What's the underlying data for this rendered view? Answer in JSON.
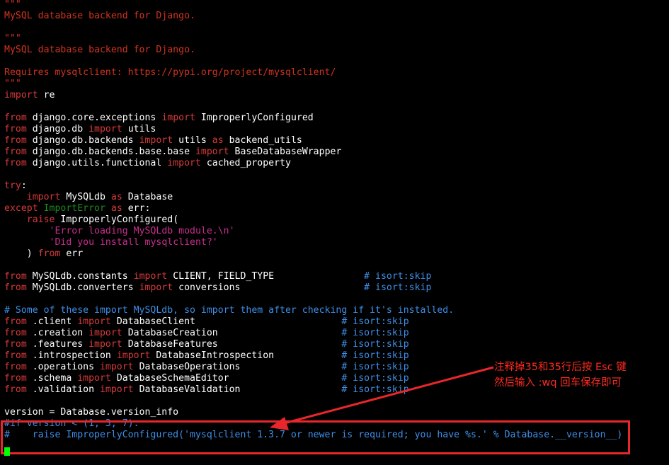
{
  "colors": {
    "background": "#000000",
    "default": "#ffffff",
    "keyword": "#d73a3a",
    "string": "#c82f8c",
    "docstring": "#d1331f",
    "comment": "#3d8fe8",
    "exception": "#1f8a1f",
    "annotation": "#ff2a1f",
    "highlight_box": "#e8262b",
    "cursor": "#00ff00"
  },
  "code_lines": [
    [
      {
        "t": "\"\"\"",
        "c": "docstring"
      }
    ],
    [
      {
        "t": "MySQL database backend for Django.",
        "c": "docstring"
      }
    ],
    [],
    [
      {
        "t": "\"\"\"",
        "c": "docstring"
      }
    ],
    [
      {
        "t": "MySQL database backend for Django.",
        "c": "docstring"
      }
    ],
    [],
    [
      {
        "t": "Requires mysqlclient: https://pypi.org/project/mysqlclient/",
        "c": "docstring"
      }
    ],
    [
      {
        "t": "\"\"\"",
        "c": "docstring"
      }
    ],
    [
      {
        "t": "import",
        "c": "keyword"
      },
      {
        "t": " re",
        "c": "default"
      }
    ],
    [],
    [
      {
        "t": "from",
        "c": "keyword"
      },
      {
        "t": " django.core.exceptions ",
        "c": "default"
      },
      {
        "t": "import",
        "c": "keyword"
      },
      {
        "t": " ImproperlyConfigured",
        "c": "default"
      }
    ],
    [
      {
        "t": "from",
        "c": "keyword"
      },
      {
        "t": " django.db ",
        "c": "default"
      },
      {
        "t": "import",
        "c": "keyword"
      },
      {
        "t": " utils",
        "c": "default"
      }
    ],
    [
      {
        "t": "from",
        "c": "keyword"
      },
      {
        "t": " django.db.backends ",
        "c": "default"
      },
      {
        "t": "import",
        "c": "keyword"
      },
      {
        "t": " utils ",
        "c": "default"
      },
      {
        "t": "as",
        "c": "keyword"
      },
      {
        "t": " backend_utils",
        "c": "default"
      }
    ],
    [
      {
        "t": "from",
        "c": "keyword"
      },
      {
        "t": " django.db.backends.base.base ",
        "c": "default"
      },
      {
        "t": "import",
        "c": "keyword"
      },
      {
        "t": " BaseDatabaseWrapper",
        "c": "default"
      }
    ],
    [
      {
        "t": "from",
        "c": "keyword"
      },
      {
        "t": " django.utils.functional ",
        "c": "default"
      },
      {
        "t": "import",
        "c": "keyword"
      },
      {
        "t": " cached_property",
        "c": "default"
      }
    ],
    [],
    [
      {
        "t": "try",
        "c": "keyword"
      },
      {
        "t": ":",
        "c": "default"
      }
    ],
    [
      {
        "t": "    ",
        "c": "default"
      },
      {
        "t": "import",
        "c": "keyword"
      },
      {
        "t": " MySQLdb ",
        "c": "default"
      },
      {
        "t": "as",
        "c": "keyword"
      },
      {
        "t": " Database",
        "c": "default"
      }
    ],
    [
      {
        "t": "except",
        "c": "keyword"
      },
      {
        "t": " ",
        "c": "default"
      },
      {
        "t": "ImportError",
        "c": "exception"
      },
      {
        "t": " ",
        "c": "default"
      },
      {
        "t": "as",
        "c": "keyword"
      },
      {
        "t": " err:",
        "c": "default"
      }
    ],
    [
      {
        "t": "    ",
        "c": "default"
      },
      {
        "t": "raise",
        "c": "keyword"
      },
      {
        "t": " ImproperlyConfigured(",
        "c": "default"
      }
    ],
    [
      {
        "t": "        ",
        "c": "default"
      },
      {
        "t": "'Error loading MySQLdb module.\\n'",
        "c": "string"
      }
    ],
    [
      {
        "t": "        ",
        "c": "default"
      },
      {
        "t": "'Did you install mysqlclient?'",
        "c": "string"
      }
    ],
    [
      {
        "t": "    ) ",
        "c": "default"
      },
      {
        "t": "from",
        "c": "keyword"
      },
      {
        "t": " err",
        "c": "default"
      }
    ],
    [],
    [
      {
        "t": "from",
        "c": "keyword"
      },
      {
        "t": " MySQLdb.constants ",
        "c": "default"
      },
      {
        "t": "import",
        "c": "keyword"
      },
      {
        "t": " CLIENT, FIELD_TYPE                ",
        "c": "default"
      },
      {
        "t": "# isort:skip",
        "c": "comment"
      }
    ],
    [
      {
        "t": "from",
        "c": "keyword"
      },
      {
        "t": " MySQLdb.converters ",
        "c": "default"
      },
      {
        "t": "import",
        "c": "keyword"
      },
      {
        "t": " conversions                      ",
        "c": "default"
      },
      {
        "t": "# isort:skip",
        "c": "comment"
      }
    ],
    [],
    [
      {
        "t": "# Some of these import MySQLdb, so import them after checking if it's installed.",
        "c": "comment"
      }
    ],
    [
      {
        "t": "from",
        "c": "keyword"
      },
      {
        "t": " .client ",
        "c": "default"
      },
      {
        "t": "import",
        "c": "keyword"
      },
      {
        "t": " DatabaseClient                          ",
        "c": "default"
      },
      {
        "t": "# isort:skip",
        "c": "comment"
      }
    ],
    [
      {
        "t": "from",
        "c": "keyword"
      },
      {
        "t": " .creation ",
        "c": "default"
      },
      {
        "t": "import",
        "c": "keyword"
      },
      {
        "t": " DatabaseCreation                      ",
        "c": "default"
      },
      {
        "t": "# isort:skip",
        "c": "comment"
      }
    ],
    [
      {
        "t": "from",
        "c": "keyword"
      },
      {
        "t": " .features ",
        "c": "default"
      },
      {
        "t": "import",
        "c": "keyword"
      },
      {
        "t": " DatabaseFeatures                      ",
        "c": "default"
      },
      {
        "t": "# isort:skip",
        "c": "comment"
      }
    ],
    [
      {
        "t": "from",
        "c": "keyword"
      },
      {
        "t": " .introspection ",
        "c": "default"
      },
      {
        "t": "import",
        "c": "keyword"
      },
      {
        "t": " DatabaseIntrospection            ",
        "c": "default"
      },
      {
        "t": "# isort:skip",
        "c": "comment"
      }
    ],
    [
      {
        "t": "from",
        "c": "keyword"
      },
      {
        "t": " .operations ",
        "c": "default"
      },
      {
        "t": "import",
        "c": "keyword"
      },
      {
        "t": " DatabaseOperations                  ",
        "c": "default"
      },
      {
        "t": "# isort:skip",
        "c": "comment"
      }
    ],
    [
      {
        "t": "from",
        "c": "keyword"
      },
      {
        "t": " .schema ",
        "c": "default"
      },
      {
        "t": "import",
        "c": "keyword"
      },
      {
        "t": " DatabaseSchemaEditor                    ",
        "c": "default"
      },
      {
        "t": "# isort:skip",
        "c": "comment"
      }
    ],
    [
      {
        "t": "from",
        "c": "keyword"
      },
      {
        "t": " .validation ",
        "c": "default"
      },
      {
        "t": "import",
        "c": "keyword"
      },
      {
        "t": " DatabaseValidation                  ",
        "c": "default"
      },
      {
        "t": "# isort:skip",
        "c": "comment"
      }
    ],
    [],
    [
      {
        "t": "version = Database.version_info",
        "c": "default"
      }
    ],
    [
      {
        "t": "#if version < (1, 3, 7):",
        "c": "comment"
      }
    ],
    [
      {
        "t": "#    raise ImproperlyConfigured('mysqlclient 1.3.7 or newer is required; you have %s.' % Database.__version__)",
        "c": "comment"
      }
    ]
  ],
  "annotation": {
    "line1": "注释掉35和35行后按 Esc 键",
    "line2": "然后输入 :wq 回车保存即可"
  }
}
